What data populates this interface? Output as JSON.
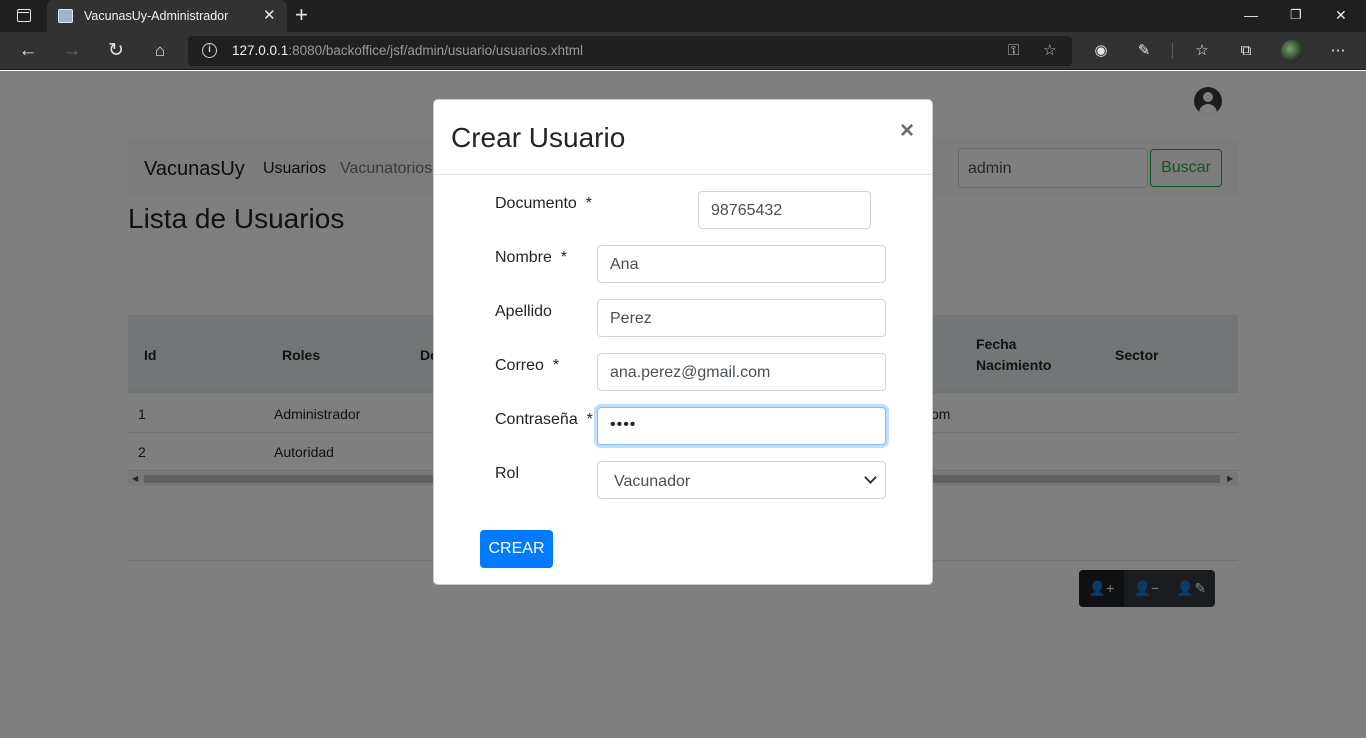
{
  "browser": {
    "tab_title": "VacunasUy-Administrador",
    "url_host": "127.0.0.1",
    "url_rest": ":8080/backoffice/jsf/admin/usuario/usuarios.xhtml"
  },
  "navbar": {
    "brand": "VacunasUy",
    "links": [
      "Usuarios",
      "Vacunatorios"
    ],
    "search_value": "admin",
    "search_button": "Buscar"
  },
  "page": {
    "title": "Lista de Usuarios"
  },
  "table": {
    "headers": {
      "id": "Id",
      "roles": "Roles",
      "partial": "De",
      "fecha_line1": "Fecha",
      "fecha_line2": "Nacimiento",
      "sector": "Sector"
    },
    "rows": [
      {
        "id": "1",
        "role": "Administrador",
        "partial": "om"
      },
      {
        "id": "2",
        "role": "Autoridad",
        "partial": ""
      }
    ]
  },
  "modal": {
    "title": "Crear Usuario",
    "close": "×",
    "fields": {
      "documento": {
        "label": "Documento",
        "value": "98765432"
      },
      "nombre": {
        "label": "Nombre",
        "value": "Ana"
      },
      "apellido": {
        "label": "Apellido",
        "value": "Perez"
      },
      "correo": {
        "label": "Correo",
        "value": "ana.perez@gmail.com"
      },
      "contrasena": {
        "label": "Contraseña",
        "value": "••••"
      },
      "rol": {
        "label": "Rol",
        "value": "Vacunador"
      }
    },
    "required_mark": "*",
    "submit": "CREAR"
  },
  "colors": {
    "primary": "#007bff",
    "success": "#28a745",
    "dark": "#343a40"
  }
}
